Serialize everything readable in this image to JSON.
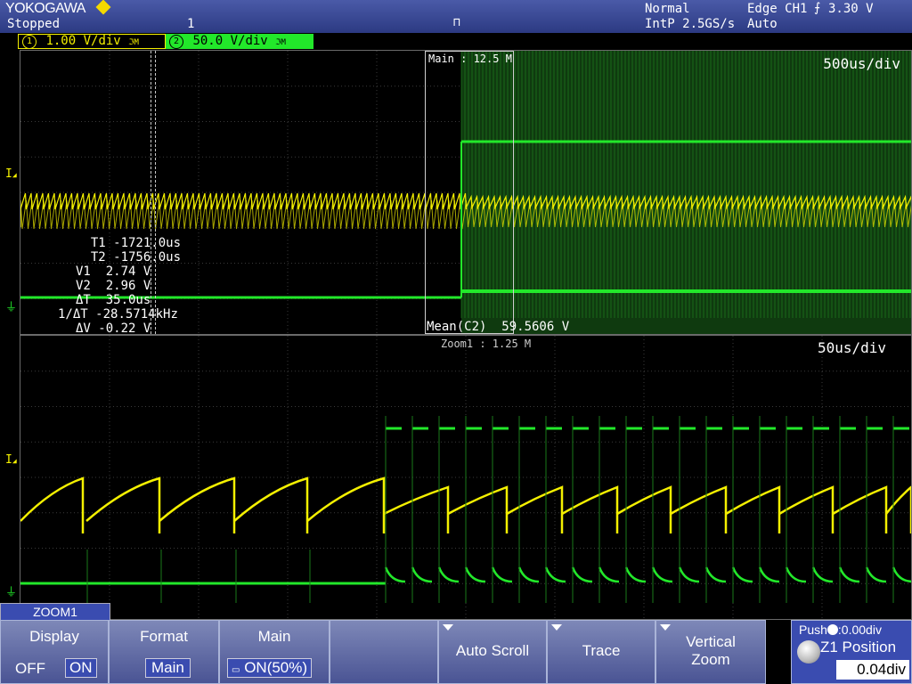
{
  "header": {
    "brand": "YOKOGAWA",
    "status": "Stopped",
    "count": "1",
    "trigger_mode": "Normal",
    "sampling": "IntP 2.5GS/s",
    "trigger_source": "Edge CH1",
    "trigger_level": "3.30 V",
    "trigger_auto": "Auto"
  },
  "channels": [
    {
      "num": "1",
      "scale": "1.00 V/div",
      "color": "#f4f000"
    },
    {
      "num": "2",
      "scale": "50.0 V/div",
      "color": "#22e82a"
    }
  ],
  "main_window": {
    "timebase": "500us/div",
    "zoom_box_label": "Main : 12.5 M",
    "measurement": "Mean(C2)  59.5606 V",
    "cursors": [
      {
        "label": "T1",
        "value": "-1721.0us"
      },
      {
        "label": "T2",
        "value": "-1756.0us"
      },
      {
        "label": "V1",
        "value": "2.74 V"
      },
      {
        "label": "V2",
        "value": "2.96 V"
      },
      {
        "label": "ΔT",
        "value": "35.0us"
      },
      {
        "label": "1/ΔT",
        "value": "-28.5714kHz"
      },
      {
        "label": "ΔV",
        "value": "-0.22 V"
      }
    ]
  },
  "zoom_window": {
    "timebase": "50us/div",
    "label": "Zoom1 : 1.25 M"
  },
  "menu": {
    "tab": "ZOOM1",
    "display": {
      "label": "Display",
      "off": "OFF",
      "on": "ON"
    },
    "format": {
      "label": "Format",
      "value": "Main"
    },
    "main": {
      "label": "Main",
      "value": "ON(50%)"
    },
    "auto_scroll": {
      "label": "Auto Scroll"
    },
    "trace": {
      "label": "Trace"
    },
    "vertical_zoom": {
      "label": "Vertical Zoom"
    },
    "position": {
      "push_hint": "Push",
      "push_value": ":0.00div",
      "label": "Z1 Position",
      "value": "0.04div"
    }
  },
  "colors": {
    "ch1": "#f4f000",
    "ch2": "#22e82a",
    "grid": "#3a3a3a"
  }
}
